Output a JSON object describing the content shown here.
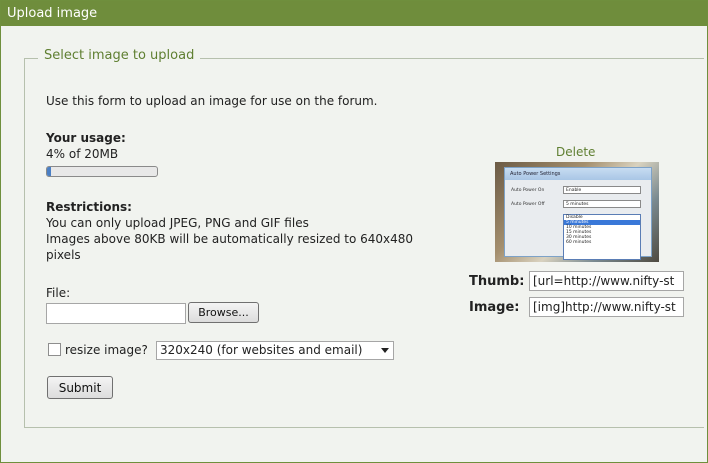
{
  "header": {
    "title": "Upload image"
  },
  "form": {
    "legend": "Select image to upload",
    "intro": "Use this form to upload an image for use on the forum.",
    "usage": {
      "heading": "Your usage:",
      "text": "4% of 20MB",
      "percent": 4
    },
    "restrictions": {
      "heading": "Restrictions:",
      "line1": "You can only upload JPEG, PNG and GIF files",
      "line2": "Images above 80KB will be automatically resized to 640x480",
      "line3": "pixels"
    },
    "file": {
      "label": "File:",
      "value": "",
      "browse_label": "Browse..."
    },
    "resize": {
      "checked": false,
      "label": "resize image?",
      "selected_option": "320x240 (for websites and email)"
    },
    "submit_label": "Submit"
  },
  "image_panel": {
    "delete_label": "Delete",
    "thumbnail": {
      "dialog_title": "Auto Power Settings",
      "row1_label": "Auto Power On",
      "row1_value": "Enable",
      "row2_label": "Auto Power Off",
      "row2_value": "5 minutes",
      "options": [
        "Disable",
        "5 minutes",
        "10 minutes",
        "15 minutes",
        "30 minutes",
        "60 minutes"
      ],
      "selected_index": 1
    },
    "thumb_label": "Thumb:",
    "thumb_code": "[url=http://www.nifty-st",
    "image_label": "Image:",
    "image_code": "[img]http://www.nifty-st"
  }
}
